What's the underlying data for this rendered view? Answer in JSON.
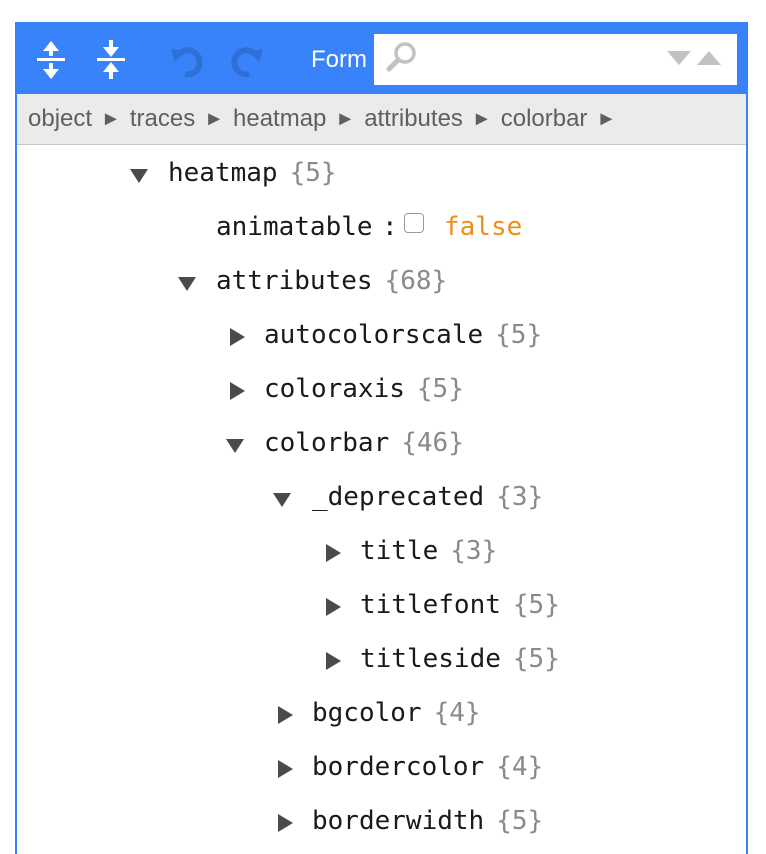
{
  "menu": {
    "expand_all": "Expand all fields",
    "collapse_all": "Collapse all fields",
    "undo": "Undo last action",
    "redo": "Redo",
    "mode_label": "Form",
    "search_placeholder": "",
    "colors": {
      "bar": "#3883fa",
      "icon": "#ffffff",
      "disabled_icon": "#2f6fd6"
    }
  },
  "breadcrumb": {
    "items": [
      "object",
      "traces",
      "heatmap",
      "attributes",
      "colorbar"
    ],
    "separator": "►"
  },
  "tree": {
    "rows": [
      {
        "key": "heatmap",
        "count": "{5}",
        "expanded": true
      },
      {
        "key": "animatable",
        "colon": ":",
        "value": "false",
        "checked": false
      },
      {
        "key": "attributes",
        "count": "{68}",
        "expanded": true
      },
      {
        "key": "autocolorscale",
        "count": "{5}",
        "expanded": false
      },
      {
        "key": "coloraxis",
        "count": "{5}",
        "expanded": false
      },
      {
        "key": "colorbar",
        "count": "{46}",
        "expanded": true
      },
      {
        "key": "_deprecated",
        "count": "{3}",
        "expanded": true
      },
      {
        "key": "title",
        "count": "{3}",
        "expanded": false
      },
      {
        "key": "titlefont",
        "count": "{5}",
        "expanded": false
      },
      {
        "key": "titleside",
        "count": "{5}",
        "expanded": false
      },
      {
        "key": "bgcolor",
        "count": "{4}",
        "expanded": false
      },
      {
        "key": "bordercolor",
        "count": "{4}",
        "expanded": false
      },
      {
        "key": "borderwidth",
        "count": "{5}",
        "expanded": false
      }
    ],
    "colors": {
      "key": "#1a1a1a",
      "count": "#8a8a8a",
      "boolean": "#ee8e1b",
      "toggle": "#4a4a4a"
    }
  }
}
